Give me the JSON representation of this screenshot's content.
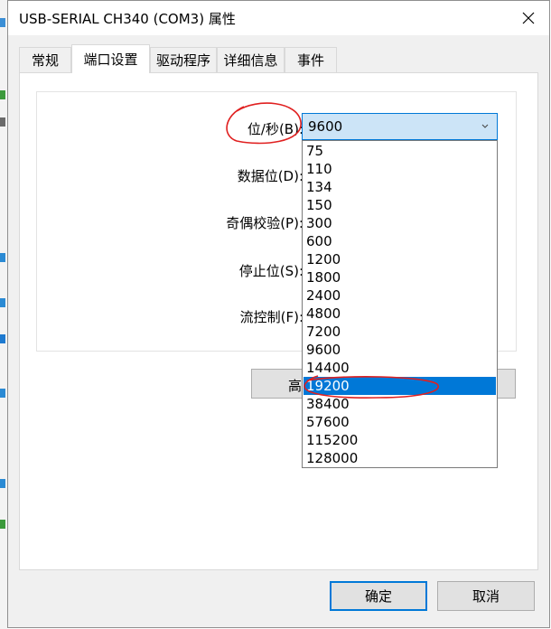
{
  "window": {
    "title": "USB-SERIAL CH340 (COM3) 属性"
  },
  "tabs": [
    {
      "label": "常规",
      "active": false
    },
    {
      "label": "端口设置",
      "active": true
    },
    {
      "label": "驱动程序",
      "active": false
    },
    {
      "label": "详细信息",
      "active": false
    },
    {
      "label": "事件",
      "active": false
    }
  ],
  "fields": {
    "baud_label": "位/秒(B):",
    "data_bits_label": "数据位(D):",
    "parity_label": "奇偶校验(P):",
    "stop_bits_label": "停止位(S):",
    "flow_label": "流控制(F):"
  },
  "baud_combo": {
    "value": "9600",
    "options": [
      "75",
      "110",
      "134",
      "150",
      "300",
      "600",
      "1200",
      "1800",
      "2400",
      "4800",
      "7200",
      "9600",
      "14400",
      "19200",
      "38400",
      "57600",
      "115200",
      "128000"
    ],
    "highlighted": "19200"
  },
  "advanced_button": {
    "label_partial": "高"
  },
  "buttons": {
    "ok": "确定",
    "cancel": "取消"
  },
  "colors": {
    "accent": "#0078d7",
    "annotation": "#e02020"
  }
}
